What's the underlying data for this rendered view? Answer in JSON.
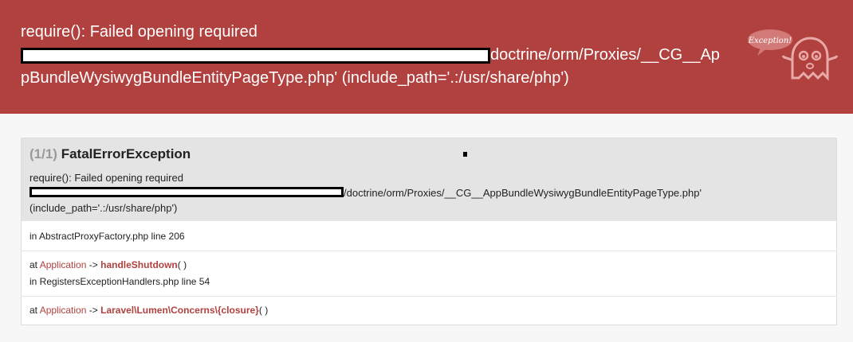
{
  "header": {
    "line1": "require(): Failed opening required",
    "line2_tail": "doctrine/orm/Proxies/__CG__Ap",
    "line3": "pBundleWysiwygBundleEntityPageType.php' (include_path='.:/usr/share/php')",
    "ghost_badge": "Exception!",
    "bg_color": "#b0413e"
  },
  "panel": {
    "count": "(1/1)",
    "exception_name": "FatalErrorException",
    "message_line1": "require(): Failed opening required",
    "message_path_tail": "/doctrine/orm/Proxies/__CG__AppBundleWysiwygBundleEntityPageType.php'",
    "message_line3": "(include_path='.:/usr/share/php')"
  },
  "trace": [
    {
      "location": "in AbstractProxyFactory.php line 206"
    },
    {
      "at": "at",
      "class": "Application",
      "arrow": "->",
      "function": "handleShutdown",
      "parens": "( )",
      "location": "in RegistersExceptionHandlers.php line 54"
    },
    {
      "at": "at",
      "class": "Application",
      "arrow": "->",
      "function": "Laravel\\Lumen\\Concerns\\{closure}",
      "parens": "( )"
    }
  ]
}
